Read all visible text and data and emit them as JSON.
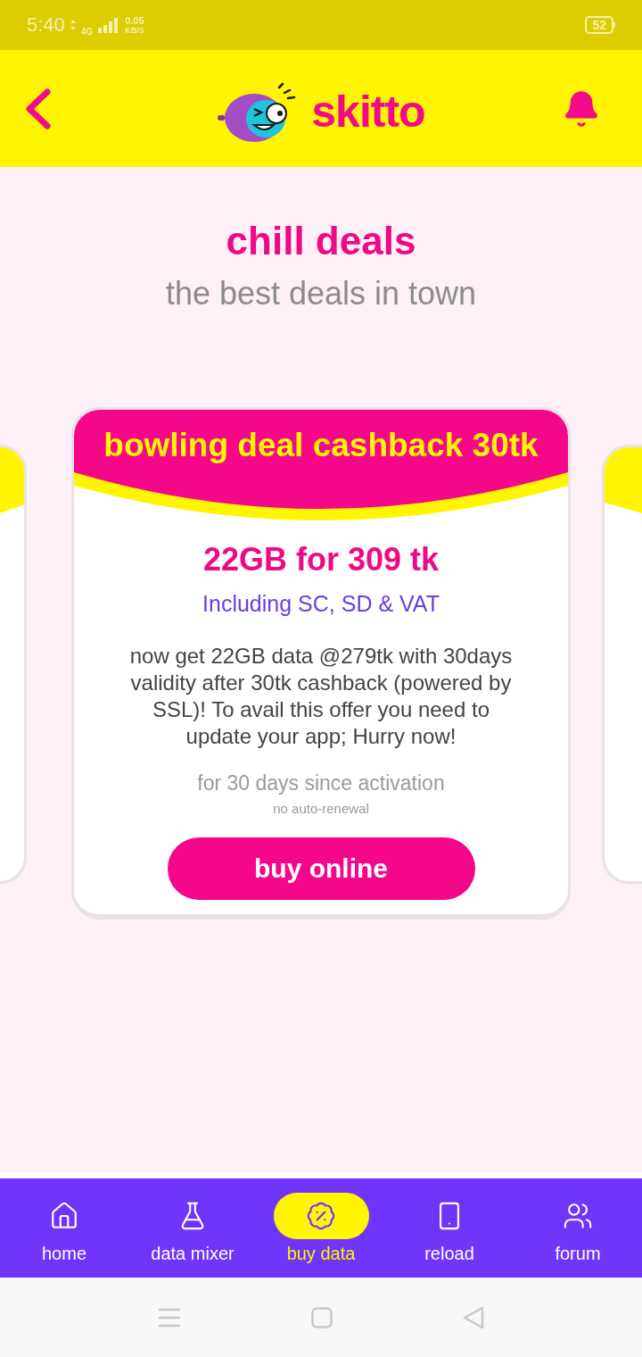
{
  "status_bar": {
    "time": "5:40",
    "network": "4G",
    "speed": "0.05",
    "speed_unit": "KB/S",
    "battery": "52"
  },
  "header": {
    "logo_text": "skitto"
  },
  "hero": {
    "title": "chill deals",
    "subtitle": "the best deals in town"
  },
  "deal": {
    "title": "bowling deal cashback 30tk",
    "price": "22GB for 309 tk",
    "tax_note": "Including SC, SD & VAT",
    "description": "now get 22GB data @279tk with 30days validity after 30tk cashback (powered by SSL)! To avail this offer you need to update your app; Hurry now!",
    "validity": "for 30 days since activation",
    "renewal": "no auto-renewal",
    "button": "buy online"
  },
  "bottom_nav": [
    {
      "label": "home",
      "selected": false
    },
    {
      "label": "data mixer",
      "selected": false
    },
    {
      "label": "buy data",
      "selected": true
    },
    {
      "label": "reload",
      "selected": false
    },
    {
      "label": "forum",
      "selected": false
    }
  ]
}
